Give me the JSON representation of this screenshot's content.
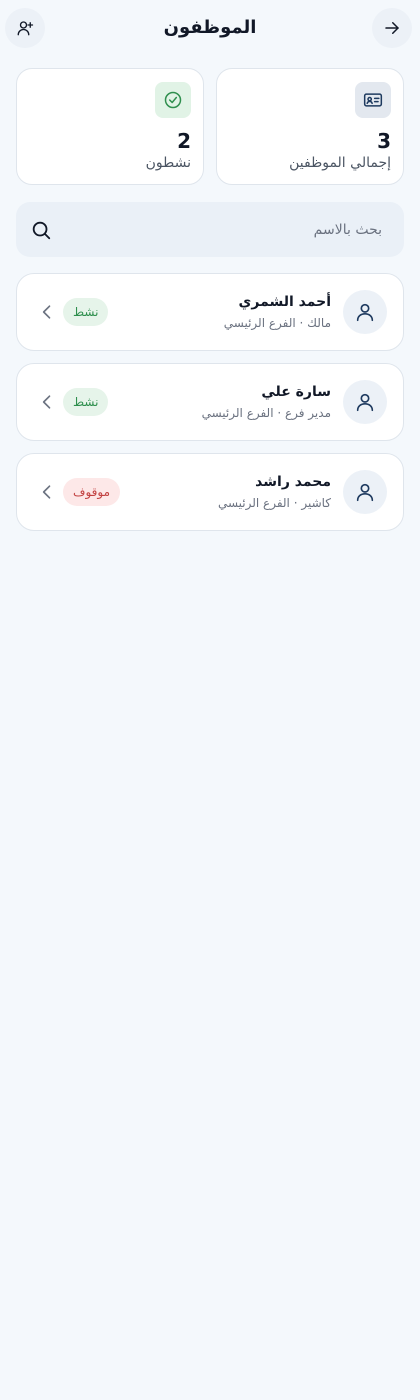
{
  "header": {
    "title": "الموظفون",
    "back_icon": "arrow-right-icon",
    "add_icon": "user-plus-icon"
  },
  "stats": {
    "total": {
      "value": "3",
      "label": "إجمالي الموظفين",
      "icon": "id-card-icon"
    },
    "active": {
      "value": "2",
      "label": "نشطون",
      "icon": "check-circle-icon"
    }
  },
  "search": {
    "placeholder": "بحث بالاسم",
    "value": ""
  },
  "employees": [
    {
      "name": "أحمد الشمري",
      "role": "مالك",
      "branch": "الفرع الرئيسي",
      "subtitle": "مالك · الفرع الرئيسي",
      "status": "نشط",
      "status_type": "active"
    },
    {
      "name": "سارة علي",
      "role": "مدير فرع",
      "branch": "الفرع الرئيسي",
      "subtitle": "مدير فرع · الفرع الرئيسي",
      "status": "نشط",
      "status_type": "active"
    },
    {
      "name": "محمد راشد",
      "role": "كاشير",
      "branch": "الفرع الرئيسي",
      "subtitle": "كاشير · الفرع الرئيسي",
      "status": "موقوف",
      "status_type": "suspended"
    }
  ],
  "colors": {
    "background": "#f4f8fc",
    "active_badge_bg": "#e6f4ea",
    "active_badge_text": "#2f8f4e",
    "suspended_badge_bg": "#fde8e8",
    "suspended_badge_text": "#c24141",
    "icon_navy": "#1e3a5f"
  }
}
